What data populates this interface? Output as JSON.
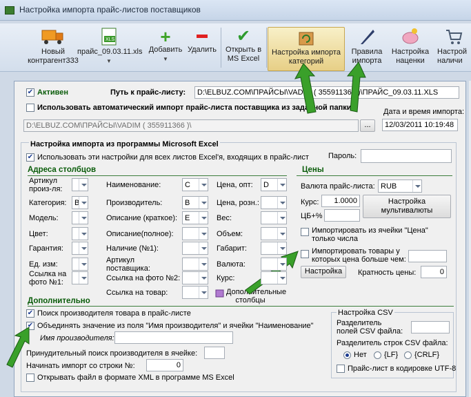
{
  "window": {
    "title": "Настройка импорта прайс-листов поставщиков"
  },
  "toolbar": {
    "new_supplier": "Новый\nконтрагент333",
    "file": "прайс_09.03.11.xls",
    "add": "Добавить",
    "remove": "Удалить",
    "open_excel": "Открыть в\nMS Excel",
    "cat_import": "Настройка импорта\nкатегорий",
    "import_rules": "Правила\nимпорта",
    "markup": "Настройка\nнаценки",
    "avail": "Настрой\nналичи"
  },
  "top": {
    "active_label": "Активен",
    "path_label": "Путь к прайс-листу:",
    "path_value": "D:\\ELBUZ.COM\\ПРАЙСЫ\\VADIM ( 355911366 )\\ПРАЙС_09.03.11.XLS",
    "auto_import_label": "Использовать автоматический импорт прайс-листа поставщика из заданной папки",
    "folder_value": "D:\\ELBUZ.COM\\ПРАЙСЫ\\VADIM ( 355911366 )\\",
    "browse": "...",
    "datetime_label": "Дата и время импорта:",
    "datetime_value": "12/03/2011 10:19:48"
  },
  "excel": {
    "group_title": "Настройка импорта из программы Microsoft Excel",
    "all_sheets_label": "Использовать эти настройки для всех листов Excel'я, входящих в прайс-лист",
    "password_label": "Пароль:"
  },
  "columns": {
    "title": "Адреса столбцов",
    "col1": [
      {
        "label": "Артикул\nпроиз-ля:",
        "value": ""
      },
      {
        "label": "Категория:",
        "value": "B"
      },
      {
        "label": "Модель:",
        "value": ""
      },
      {
        "label": "Цвет:",
        "value": ""
      },
      {
        "label": "Гарантия:",
        "value": ""
      },
      {
        "label": "Ед. изм:",
        "value": ""
      },
      {
        "label": "Ссылка на\nфото №1:",
        "value": ""
      }
    ],
    "col2": [
      {
        "label": "Наименование:",
        "value": "C"
      },
      {
        "label": "Производитель:",
        "value": "B"
      },
      {
        "label": "Описание (краткое):",
        "value": "E"
      },
      {
        "label": "Описание(полное):",
        "value": ""
      },
      {
        "label": "Наличие (№1):",
        "value": ""
      },
      {
        "label": "Артикул\nпоставщика:",
        "value": ""
      },
      {
        "label": "Ссылка на фото №2:",
        "value": ""
      },
      {
        "label": "Ссылка на товар:",
        "value": ""
      }
    ],
    "col3": [
      {
        "label": "Цена, опт:",
        "value": "D"
      },
      {
        "label": "Цена, розн.:",
        "value": ""
      },
      {
        "label": "Вес:",
        "value": ""
      },
      {
        "label": "Объем:",
        "value": ""
      },
      {
        "label": "Габарит:",
        "value": ""
      },
      {
        "label": "Валюта:",
        "value": ""
      },
      {
        "label": "Курс:",
        "value": ""
      }
    ],
    "extra_cols": "Дополнительные\nстолбцы"
  },
  "prices": {
    "title": "Цены",
    "currency_label": "Валюта прайс-листа:",
    "currency_value": "RUB",
    "rate_label": "Курс:",
    "rate_value": "1.0000",
    "cb_label": "ЦБ+%",
    "multi_btn": "Настройка\nмультивалюты",
    "import_from_cell": "Импортировать из ячейки \"Цена\"\nтолько числа",
    "import_price_gt": "Импортировать товары у\nкоторых цена больше чем:",
    "settings_btn": "Настройка",
    "multiplicity_label": "Кратность цены:",
    "multiplicity_value": "0"
  },
  "extra": {
    "title": "Дополнительно",
    "search_in_sheet": "Поиск производителя товара в прайс-листе",
    "merge_names": "Объединять значение из поля \"Имя производителя\" и ячейки \"Наименование\"",
    "vendor_name_label": "Имя производителя:",
    "force_search": "Принудительный поиск производителя в ячейке:",
    "start_row_label": "Начинать импорт со строки №:",
    "start_row_value": "0",
    "open_xml": "Открывать файл в формате XML в программе MS Excel"
  },
  "csv": {
    "title": "Настройка CSV",
    "field_sep": "Разделитель\nполей CSV файла:",
    "row_sep": "Разделитель строк CSV файла:",
    "opt_none": "Нет",
    "opt_lf": "{LF}",
    "opt_crlf": "{CRLF}",
    "utf8": "Прайс-лист в кодировке UTF-8"
  }
}
